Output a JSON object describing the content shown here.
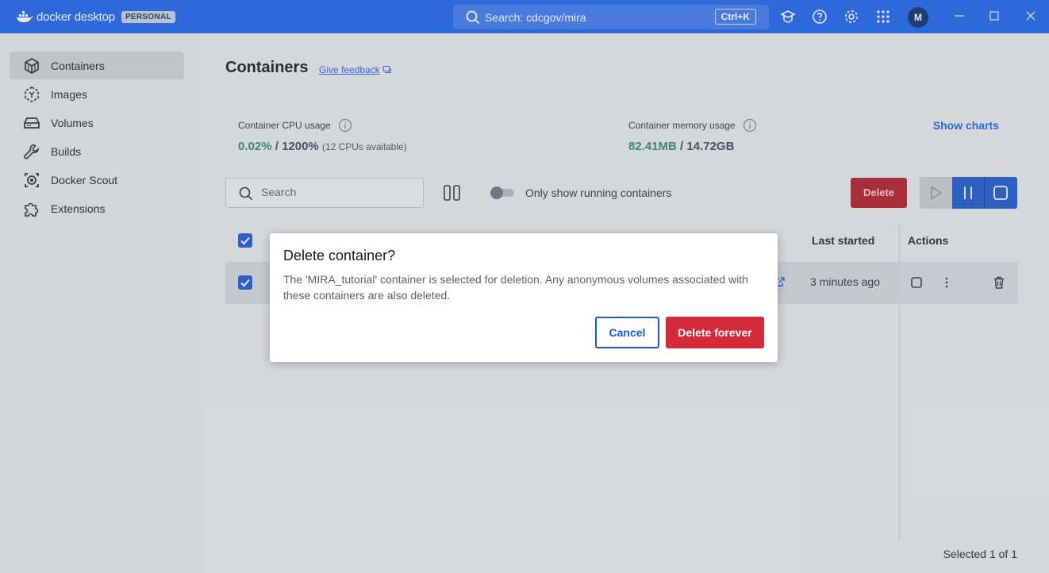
{
  "titlebar": {
    "app_name": "docker desktop",
    "plan_badge": "PERSONAL",
    "search_text": "Search: cdcgov/mira",
    "search_shortcut": "Ctrl+K",
    "avatar_initial": "M",
    "icons": [
      "learning-center-icon",
      "help-icon",
      "settings-icon",
      "extensions-grid-icon",
      "minimize-icon",
      "maximize-icon",
      "close-icon"
    ]
  },
  "sidebar": {
    "items": [
      {
        "label": "Containers",
        "icon": "container-icon",
        "active": true
      },
      {
        "label": "Images",
        "icon": "image-icon",
        "active": false
      },
      {
        "label": "Volumes",
        "icon": "volume-icon",
        "active": false
      },
      {
        "label": "Builds",
        "icon": "wrench-icon",
        "active": false
      },
      {
        "label": "Docker Scout",
        "icon": "scout-icon",
        "active": false
      },
      {
        "label": "Extensions",
        "icon": "puzzle-icon",
        "active": false
      }
    ]
  },
  "main": {
    "title": "Containers",
    "feedback_link": "Give feedback",
    "cpu": {
      "label": "Container CPU usage",
      "value": "0.02%",
      "separator": " / ",
      "total": "1200%",
      "note": "(12 CPUs available)"
    },
    "memory": {
      "label": "Container memory usage",
      "value": "82.41MB",
      "separator": " / ",
      "total": "14.72GB"
    },
    "show_charts": "Show charts",
    "search_placeholder": "Search",
    "toggle_label": "Only show running containers",
    "delete_label": "Delete",
    "table": {
      "headers": {
        "last_started": "Last started",
        "actions": "Actions"
      },
      "rows": [
        {
          "last_started": "3 minutes ago",
          "selected": true
        }
      ]
    },
    "footer": "Selected 1 of 1"
  },
  "dialog": {
    "title": "Delete container?",
    "body": "The 'MIRA_tutorial' container is selected for deletion. Any anonymous volumes associated with these containers are also deleted.",
    "cancel_label": "Cancel",
    "confirm_label": "Delete forever"
  },
  "colors": {
    "brand_blue": "#1d63ed",
    "danger_red": "#d42a3a",
    "usage_green": "#2e8b6a"
  }
}
